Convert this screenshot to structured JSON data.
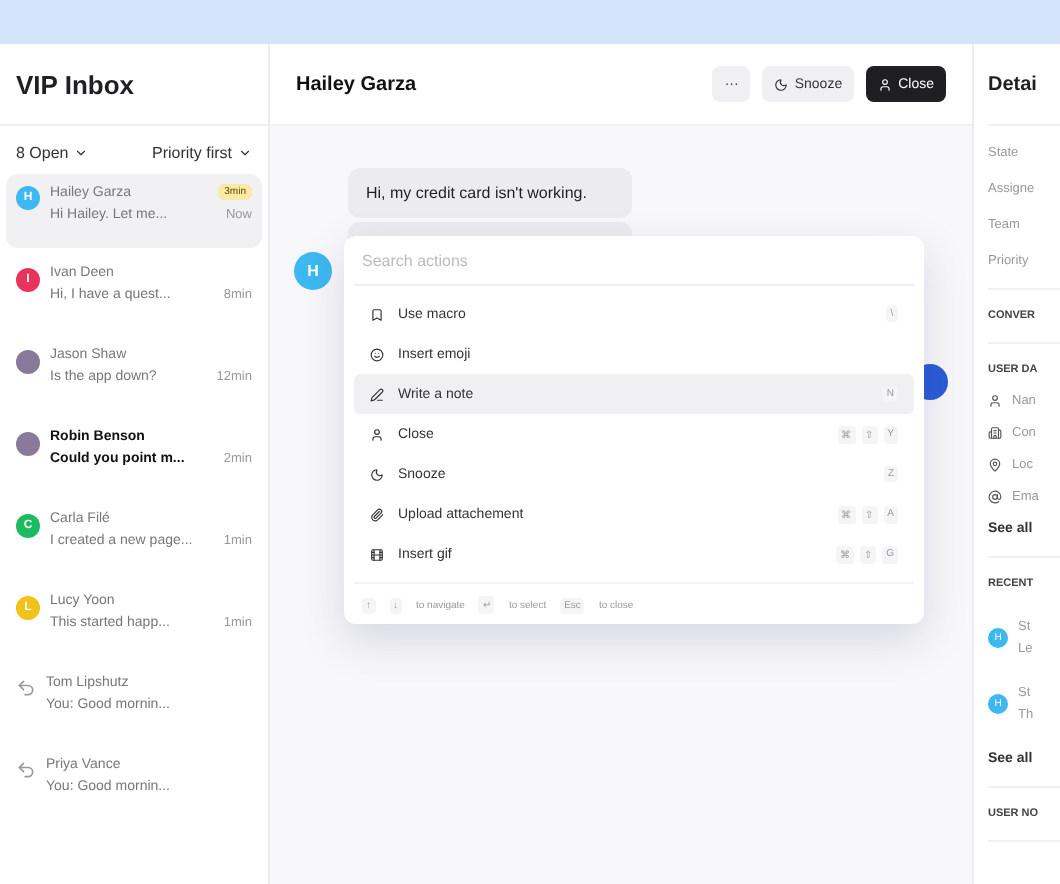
{
  "inbox": {
    "title": "VIP Inbox",
    "filter": "8 Open",
    "sort": "Priority first",
    "items": [
      {
        "kind": "letter",
        "initial": "H",
        "color": "#3db8f0",
        "name": "Hailey Garza",
        "preview": "Hi Hailey. Let me...",
        "time": "Now",
        "badge": "3min",
        "selected": true,
        "unread": false
      },
      {
        "kind": "letter",
        "initial": "I",
        "color": "#e8345a",
        "name": "Ivan Deen",
        "preview": "Hi, I have a quest...",
        "time": "8min",
        "selected": false,
        "unread": false
      },
      {
        "kind": "photo",
        "name": "Jason Shaw",
        "preview": "Is the app down?",
        "time": "12min",
        "selected": false,
        "unread": false
      },
      {
        "kind": "photo",
        "name": "Robin Benson",
        "preview": "Could you point m...",
        "time": "2min",
        "selected": false,
        "unread": true
      },
      {
        "kind": "letter",
        "initial": "C",
        "color": "#1dbb5f",
        "name": "Carla Filé",
        "preview": "I created a new page...",
        "time": "1min",
        "selected": false,
        "unread": false
      },
      {
        "kind": "letter",
        "initial": "L",
        "color": "#f0c21b",
        "name": "Lucy Yoon",
        "preview": "This started happ...",
        "time": "1min",
        "selected": false,
        "unread": false
      },
      {
        "kind": "replied",
        "name": "Tom Lipshutz",
        "preview": "You: Good mornin...",
        "selected": false,
        "unread": false
      },
      {
        "kind": "replied",
        "name": "Priya Vance",
        "preview": "You: Good mornin...",
        "selected": false,
        "unread": false
      }
    ]
  },
  "conversation": {
    "title": "Hailey Garza",
    "more": "···",
    "snooze": "Snooze",
    "close": "Close",
    "avatar_initial": "H",
    "message": "Hi, my credit card isn't working."
  },
  "palette": {
    "placeholder": "Search actions",
    "actions": [
      {
        "label": "Use macro",
        "keys": [
          "\\"
        ],
        "selected": false
      },
      {
        "label": "Insert emoji",
        "selected": false
      },
      {
        "label": "Write a note",
        "keys": [
          "N"
        ],
        "selected": true
      },
      {
        "label": "Close",
        "keys": [
          "⌘",
          "⇧",
          "Y"
        ],
        "selected": false
      },
      {
        "label": "Snooze",
        "keys": [
          "Z"
        ],
        "selected": false
      },
      {
        "label": "Upload attachement",
        "keys": [
          "⌘",
          "⇧",
          "A"
        ],
        "selected": false
      },
      {
        "label": "Insert gif",
        "keys": [
          "⌘",
          "⇧",
          "G"
        ],
        "selected": false
      }
    ],
    "hints": [
      {
        "keys": [
          "↑",
          "↓"
        ],
        "text": "to navigate"
      },
      {
        "keys": [
          "↵"
        ],
        "text": "to select"
      },
      {
        "keys": [
          "Esc"
        ],
        "text": "to close"
      }
    ]
  },
  "details": {
    "title": "Detai",
    "fields": [
      "State",
      "Assigne",
      "Team",
      "Priority"
    ],
    "sections": [
      {
        "kind": "heading",
        "label": "CONVER"
      },
      {
        "kind": "userdata",
        "label": "USER DA",
        "rows": [
          {
            "text": "Nan"
          },
          {
            "text": "Con"
          },
          {
            "text": "Loc"
          },
          {
            "text": "Ema"
          }
        ],
        "link": "See all"
      },
      {
        "kind": "recent",
        "label": "RECENT",
        "rows": [
          {
            "initial": "H",
            "line1": "St",
            "line2": "Le"
          },
          {
            "initial": "H",
            "line1": "St",
            "line2": "Th"
          }
        ],
        "link": "See all"
      },
      {
        "kind": "heading",
        "label": "USER NO"
      }
    ]
  }
}
